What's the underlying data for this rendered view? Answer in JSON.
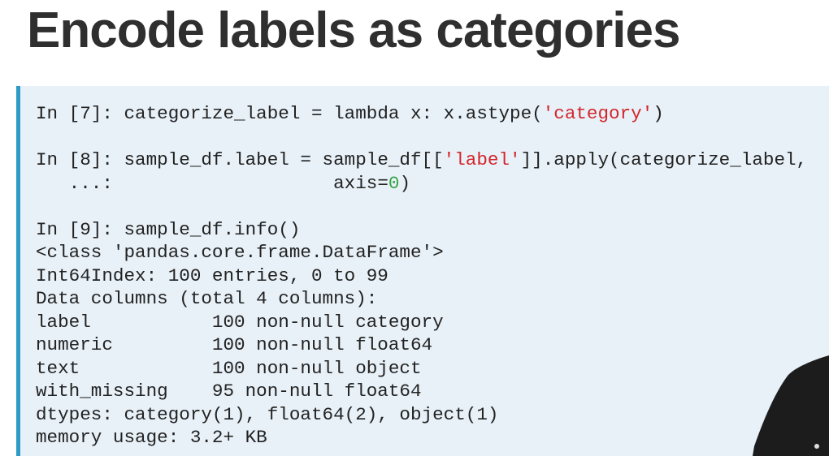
{
  "title": "Encode labels as categories",
  "cells": [
    {
      "prompt": "In [7]: ",
      "code_a": "categorize_label = lambda x: x.astype(",
      "str": "'category'",
      "code_b": ")"
    },
    {
      "prompt": "In [8]: ",
      "code_a": "sample_df.label = sample_df[[",
      "str": "'label'",
      "code_b": "]].apply(categorize_label,",
      "cont_prompt": "   ...: ",
      "cont_a": "                   axis=",
      "num": "0",
      "cont_b": ")"
    },
    {
      "prompt": "In [9]: ",
      "code_a": "sample_df.info()"
    }
  ],
  "output": [
    "<class 'pandas.core.frame.DataFrame'>",
    "Int64Index: 100 entries, 0 to 99",
    "Data columns (total 4 columns):",
    "label           100 non-null category",
    "numeric         100 non-null float64",
    "text            100 non-null object",
    "with_missing    95 non-null float64",
    "dtypes: category(1), float64(2), object(1)",
    "memory usage: 3.2+ KB"
  ]
}
